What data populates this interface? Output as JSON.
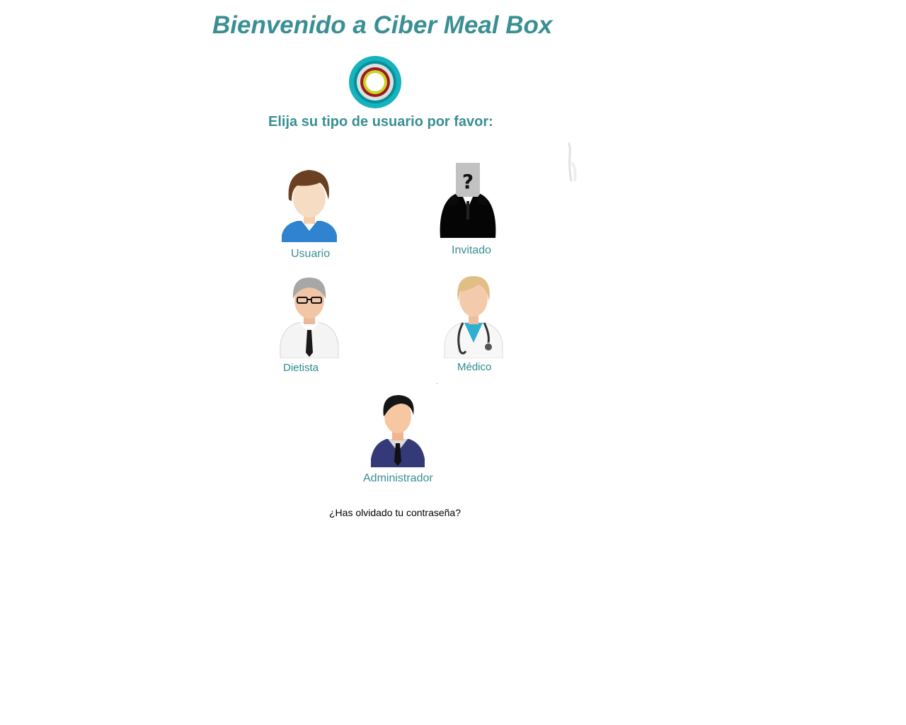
{
  "header": {
    "title": "Bienvenido a Ciber Meal Box",
    "subtitle": "Elija su tipo de usuario por favor:"
  },
  "logo": {
    "icon": "ring-logo-icon"
  },
  "roles": [
    {
      "label": "Usuario",
      "icon": "user-avatar-icon"
    },
    {
      "label": "Invitado",
      "icon": "guest-question-icon"
    },
    {
      "label": "Dietista",
      "icon": "dietitian-avatar-icon"
    },
    {
      "label": "Médico",
      "icon": "doctor-avatar-icon"
    },
    {
      "label": "Administrador",
      "icon": "admin-avatar-icon"
    }
  ],
  "forgot_password": "¿Has olvidado tu contraseña?",
  "colors": {
    "accent": "#3a8f93",
    "text": "#000000",
    "background": "#ffffff"
  }
}
